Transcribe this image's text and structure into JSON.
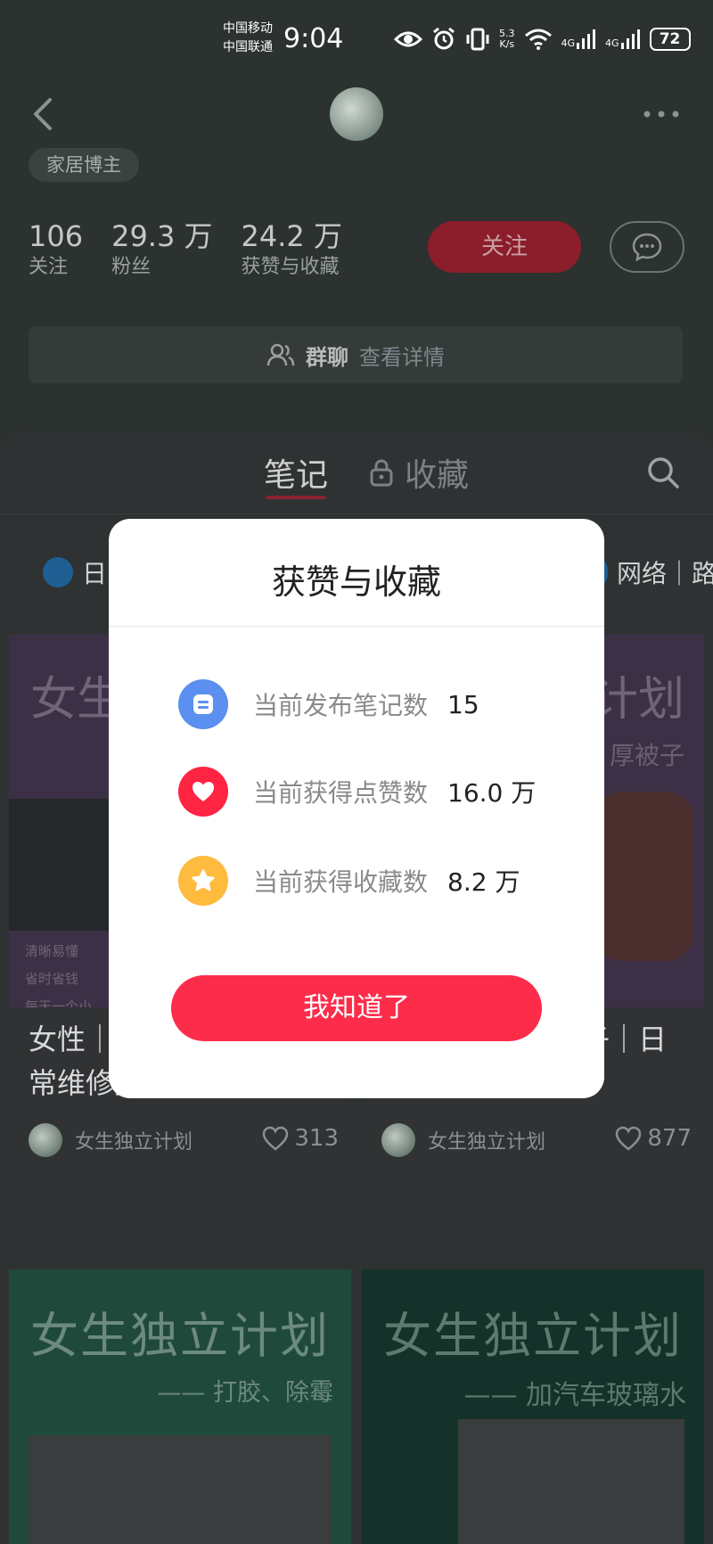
{
  "status_bar": {
    "carrier_1": "中国移动",
    "carrier_2": "中国联通",
    "time": "9:04",
    "net_speed_top": "5.3",
    "net_speed_bottom": "K/s",
    "signal_1": "4G",
    "signal_2": "4G",
    "battery": "72"
  },
  "profile": {
    "tag": "家居博主",
    "stats": [
      {
        "value": "106",
        "label": "关注"
      },
      {
        "value": "29.3 万",
        "label": "粉丝"
      },
      {
        "value": "24.2 万",
        "label": "获赞与收藏"
      }
    ],
    "follow_label": "关注",
    "group_label": "群聊",
    "group_detail": "查看详情"
  },
  "tabs": {
    "notes": "笔记",
    "favorites": "收藏"
  },
  "chips": {
    "left": "日",
    "right": "网络｜路"
  },
  "cards": [
    {
      "cover_title": "女生",
      "cover_lines": [
        "清晰易懂",
        "省时省钱",
        "每天一个小"
      ],
      "title": "女性｜处理旧床垫｜日常维修更换",
      "author": "女生独立计划",
      "likes": "313"
    },
    {
      "cover_title": "计划",
      "cover_sub": "厚被子",
      "title": "女性｜收纳厚被子｜日常收纳",
      "author": "女生独立计划",
      "likes": "877"
    },
    {
      "cover_title": "女生独立计划",
      "cover_sub": "—— 打胶、除霉"
    },
    {
      "cover_title": "女生独立计划",
      "cover_sub": "—— 加汽车玻璃水"
    }
  ],
  "modal": {
    "title": "获赞与收藏",
    "rows": [
      {
        "label": "当前发布笔记数",
        "value": "15",
        "icon": "note-icon",
        "color": "#5b8ff0"
      },
      {
        "label": "当前获得点赞数",
        "value": "16.0 万",
        "icon": "heart-icon",
        "color": "#ff2442"
      },
      {
        "label": "当前获得收藏数",
        "value": "8.2 万",
        "icon": "star-icon",
        "color": "#ffbb3d"
      }
    ],
    "button": "我知道了"
  },
  "colors": {
    "accent": "#fe2c4b",
    "overlay_bg": "#2b3230"
  }
}
